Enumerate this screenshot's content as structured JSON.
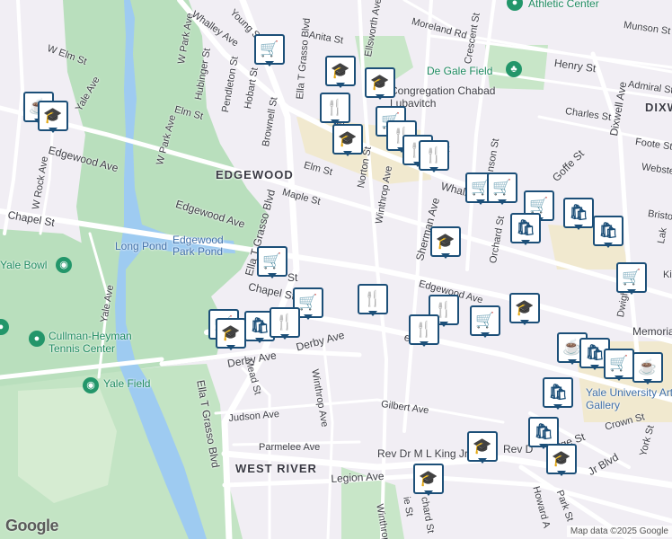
{
  "colors": {
    "park": "#b9dfbd",
    "water": "#9ecbf1",
    "road": "#ffffff",
    "school_area": "#f1e9cf",
    "pin_border": "#1c4f78",
    "poi_green": "#23966a"
  },
  "areas": {
    "edgewood": "EDGEWOOD",
    "west_river": "WEST RIVER",
    "dixwell": "DIXW"
  },
  "streets": {
    "w_elm": "W Elm St",
    "w_park": "W Park Ave",
    "whalley": "Whalley Ave",
    "young": "Young St",
    "ella_blvd_top": "Ella T Grasso Blvd",
    "anita": "Anita St",
    "ellsworth": "Ellsworth Ave",
    "moreland": "Moreland Rd",
    "crescent": "Crescent St",
    "munson": "Munson St",
    "henry": "Henry St",
    "dixwell_ave": "Dixwell Ave",
    "admiral": "Admiral St",
    "charles": "Charles St",
    "foote": "Foote St",
    "webster": "Webster",
    "goffe": "Goffe St",
    "bristol": "Bristo",
    "lake": "Lak",
    "hubinger": "Hubinger St",
    "pendleton": "Pendleton St",
    "hobart": "Hobart St",
    "brownell": "Brownell St",
    "elm_w": "Elm St",
    "w_rock": "W Rock Ave",
    "yale_ave_top": "Yale Ave",
    "w_park2": "W Park Ave",
    "edgewood_w": "Edgewood Ave",
    "edgewood_mid": "Edgewood Ave",
    "edgewood_e": "Edgewood Ave",
    "elm_e": "Elm St",
    "maple": "Maple St",
    "norton": "Norton St",
    "winthrop_n": "Winthrop Ave",
    "sherman": "Sherman Ave",
    "whalley_e": "Whalle",
    "chapel_w": "Chapel St",
    "chapel_mid": "Chapel St",
    "chapel_st2": "St",
    "chapel_e": "el St",
    "orchard": "Orchard St",
    "dwight": "Dwight St",
    "ella_blvd_mid": "Ella T Grasso Blvd",
    "yale_ave": "Yale Ave",
    "derby": "Derby Ave",
    "derby2": "Derby Ave",
    "mead": "Mead St",
    "ella_blvd_low": "Ella T Grasso Blvd",
    "winthrop_s": "Winthrop Ave",
    "judson": "Judson Ave",
    "gilbert": "Gilbert Ave",
    "parmelee": "Parmelee Ave",
    "mlk": "Rev Dr M L King Jr",
    "mlk2": "Rev D",
    "legion": "Legion Ave",
    "winthrop_low": "Winthrop Ave",
    "richard": "chard St",
    "howard": "Howard A",
    "park_st": "Park St",
    "jr_blvd": "Jr Blvd",
    "crown": "Crown St",
    "york": "York St",
    "rge": "rge St",
    "ie_st": "ie St",
    "st_frag": "St",
    "ro_frag": "Pr",
    "n_frag": "nson St",
    "ki": "Ki",
    "elm_frag": "El"
  },
  "places": {
    "athletic_center": "Athletic Center",
    "de_gale_field": "De Gale Field",
    "congregation": "Congregation Chabad Lubavitch",
    "long_pond": "Long Pond",
    "edgewood_park_pond": "Edgewood Park Pond",
    "yale_bowl": "Yale Bowl",
    "cullman": "Cullman-Heyman Tennis Center",
    "yale_field": "Yale Field",
    "memorial": "Memoria",
    "yale_gallery": "Yale University Art Gallery"
  },
  "pins": [
    {
      "icon": "cart-icon",
      "glyph": "🛒"
    },
    {
      "icon": "school-icon",
      "glyph": "🎓"
    },
    {
      "icon": "school-icon",
      "glyph": "🎓"
    },
    {
      "icon": "restaurant-icon",
      "glyph": "🍴"
    },
    {
      "icon": "school-icon",
      "glyph": "🎓"
    },
    {
      "icon": "cafe-icon",
      "glyph": "☕"
    },
    {
      "icon": "school-icon",
      "glyph": "🎓"
    },
    {
      "icon": "cart-icon",
      "glyph": "🛒"
    },
    {
      "icon": "restaurant-icon",
      "glyph": "🍴"
    },
    {
      "icon": "restaurant-icon",
      "glyph": "🍴"
    },
    {
      "icon": "restaurant-icon",
      "glyph": "🍴"
    },
    {
      "icon": "cart-icon",
      "glyph": "🛒"
    },
    {
      "icon": "cart-icon",
      "glyph": "🛒"
    },
    {
      "icon": "cart-icon",
      "glyph": "🛒"
    },
    {
      "icon": "bag-icon",
      "glyph": "🛍"
    },
    {
      "icon": "bag-icon",
      "glyph": "🛍"
    },
    {
      "icon": "bag-icon",
      "glyph": "🛍"
    },
    {
      "icon": "cart-icon",
      "glyph": "🛒"
    },
    {
      "icon": "school-icon",
      "glyph": "🎓"
    },
    {
      "icon": "cart-icon",
      "glyph": "🛒"
    },
    {
      "icon": "restaurant-icon",
      "glyph": "🍴"
    },
    {
      "icon": "cart-icon",
      "glyph": "🛒"
    },
    {
      "icon": "restaurant-icon",
      "glyph": "🍴"
    },
    {
      "icon": "restaurant-icon",
      "glyph": "🍴"
    },
    {
      "icon": "cart-icon",
      "glyph": "🛒"
    },
    {
      "icon": "school-icon",
      "glyph": "🎓"
    },
    {
      "icon": "cart-icon",
      "glyph": "🛒"
    },
    {
      "icon": "school-icon",
      "glyph": "🎓"
    },
    {
      "icon": "bag-icon",
      "glyph": "🛍"
    },
    {
      "icon": "restaurant-icon",
      "glyph": "🍴"
    },
    {
      "icon": "cafe-icon",
      "glyph": "☕"
    },
    {
      "icon": "bag-icon",
      "glyph": "🛍"
    },
    {
      "icon": "cart-icon",
      "glyph": "🛒"
    },
    {
      "icon": "cafe-icon",
      "glyph": "☕"
    },
    {
      "icon": "bag-icon",
      "glyph": "🛍"
    },
    {
      "icon": "bag-icon",
      "glyph": "🛍"
    },
    {
      "icon": "school-icon",
      "glyph": "🎓"
    },
    {
      "icon": "school-icon",
      "glyph": "🎓"
    },
    {
      "icon": "school-icon",
      "glyph": "🎓"
    }
  ],
  "footer": {
    "logo": "Google",
    "attribution": "Map data ©2025 Google"
  }
}
